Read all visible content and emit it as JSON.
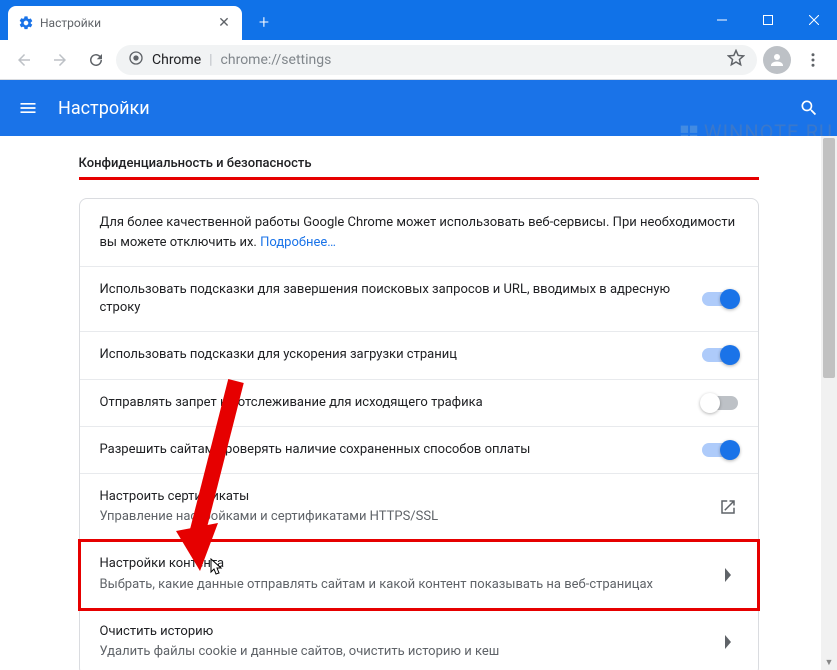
{
  "window": {
    "tab_title": "Настройки"
  },
  "urlbar": {
    "host": "Chrome",
    "path": "chrome://settings"
  },
  "header": {
    "title": "Настройки"
  },
  "watermark": "WINNOTE.RU",
  "section": {
    "title": "Конфиденциальность и безопасность"
  },
  "intro": {
    "text": "Для более качественной работы Google Chrome может использовать веб-сервисы. При необходимости вы можете отключить их. ",
    "link": "Подробнее…"
  },
  "rows": [
    {
      "title": "Использовать подсказки для завершения поисковых запросов и URL, вводимых в адресную строку",
      "toggle": true
    },
    {
      "title": "Использовать подсказки для ускорения загрузки страниц",
      "toggle": true
    },
    {
      "title": "Отправлять запрет на отслеживание для исходящего трафика",
      "toggle": false
    },
    {
      "title": "Разрешить сайтам проверять наличие сохраненных способов оплаты",
      "toggle": true
    },
    {
      "title": "Настроить сертификаты",
      "sub": "Управление настройками и сертификатами HTTPS/SSL",
      "action": "external"
    },
    {
      "title": "Настройки контента",
      "sub": "Выбрать, какие данные отправлять сайтам и какой контент показывать на веб-страницах",
      "action": "arrow",
      "highlight": true
    },
    {
      "title": "Очистить историю",
      "sub": "Удалить файлы cookie и данные сайтов, очистить историю и кеш",
      "action": "arrow"
    }
  ]
}
